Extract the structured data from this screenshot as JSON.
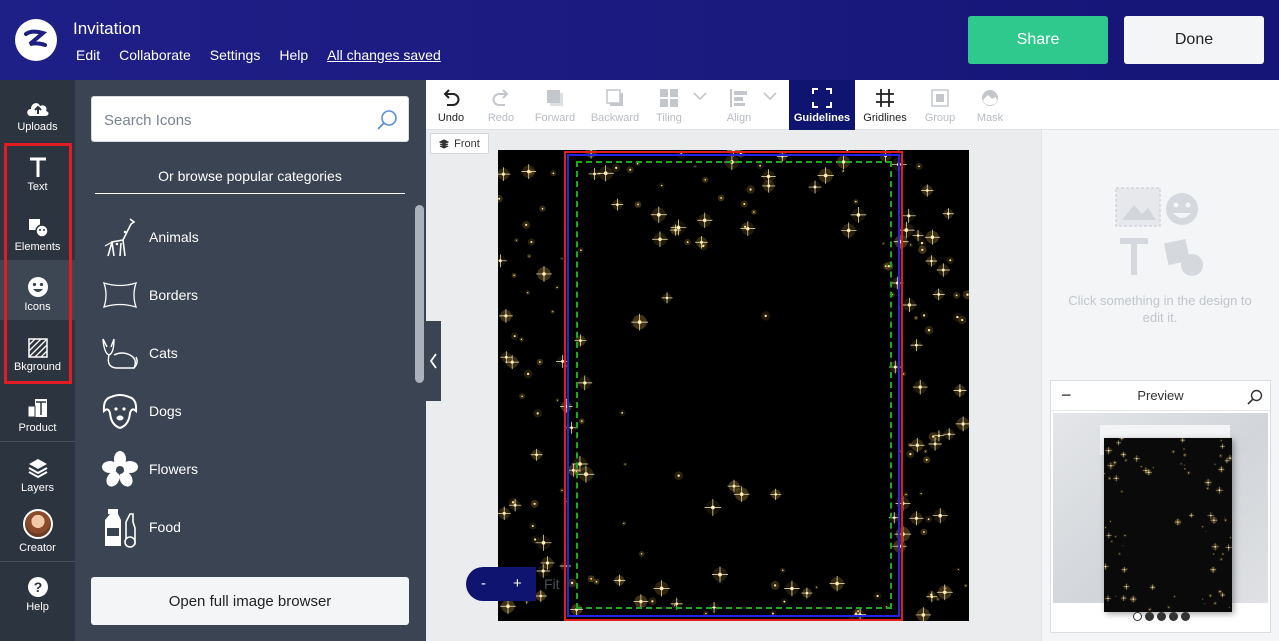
{
  "app": {
    "title": "Invitation",
    "menu": [
      "Edit",
      "Collaborate",
      "Settings",
      "Help"
    ],
    "saved_status": "All changes saved",
    "share_label": "Share",
    "done_label": "Done",
    "logo_icon": "zazzle-z-logo"
  },
  "rail": {
    "items": [
      {
        "label": "Uploads",
        "icon": "cloud-upload-icon"
      },
      {
        "label": "Text",
        "icon": "text-icon"
      },
      {
        "label": "Elements",
        "icon": "elements-icon"
      },
      {
        "label": "Icons",
        "icon": "smiley-icon",
        "active": true
      },
      {
        "label": "Bkground",
        "icon": "background-icon"
      },
      {
        "label": "Product",
        "icon": "product-icon"
      },
      {
        "label": "Layers",
        "icon": "layers-icon"
      },
      {
        "label": "Creator",
        "icon": "avatar"
      },
      {
        "label": "Help",
        "icon": "help-icon"
      }
    ]
  },
  "panel": {
    "search_placeholder": "Search Icons",
    "browse_heading": "Or browse popular categories",
    "categories": [
      {
        "label": "Animals",
        "icon": "giraffe-icon"
      },
      {
        "label": "Borders",
        "icon": "border-icon"
      },
      {
        "label": "Cats",
        "icon": "cat-icon"
      },
      {
        "label": "Dogs",
        "icon": "dog-icon"
      },
      {
        "label": "Flowers",
        "icon": "flower-icon"
      },
      {
        "label": "Food",
        "icon": "food-icon"
      }
    ],
    "open_browser_label": "Open full image browser"
  },
  "toolbar": {
    "tools": [
      {
        "label": "Undo",
        "icon": "undo-icon",
        "enabled": true
      },
      {
        "label": "Redo",
        "icon": "redo-icon",
        "enabled": false
      },
      {
        "label": "Forward",
        "icon": "forward-icon",
        "enabled": false
      },
      {
        "label": "Backward",
        "icon": "backward-icon",
        "enabled": false
      },
      {
        "label": "Tiling",
        "icon": "tiling-icon",
        "enabled": false
      },
      {
        "label": "Align",
        "icon": "align-icon",
        "enabled": false
      },
      {
        "label": "Guidelines",
        "icon": "guidelines-icon",
        "enabled": true,
        "active": true
      },
      {
        "label": "Gridlines",
        "icon": "gridlines-icon",
        "enabled": true
      },
      {
        "label": "Group",
        "icon": "group-icon",
        "enabled": false
      },
      {
        "label": "Mask",
        "icon": "mask-icon",
        "enabled": false
      }
    ]
  },
  "canvas": {
    "side_tab": "Front",
    "zoom_minus": "-",
    "zoom_plus": "+",
    "zoom_fit": "Fit",
    "guide_colors": {
      "bleed": "#e21c1c",
      "trim": "#2424e0",
      "safe": "#1fa81f"
    }
  },
  "right": {
    "hint": "Click something in the design to edit it.",
    "preview_title": "Preview",
    "preview_pages": 5,
    "preview_active_page": 1
  },
  "colors": {
    "topbar": "#1a1a80",
    "share": "#2fc98e",
    "rail": "#2c3440",
    "panel": "#3a4452",
    "guidelines_active": "#0f1470",
    "highlight_box": "#e31b23"
  }
}
